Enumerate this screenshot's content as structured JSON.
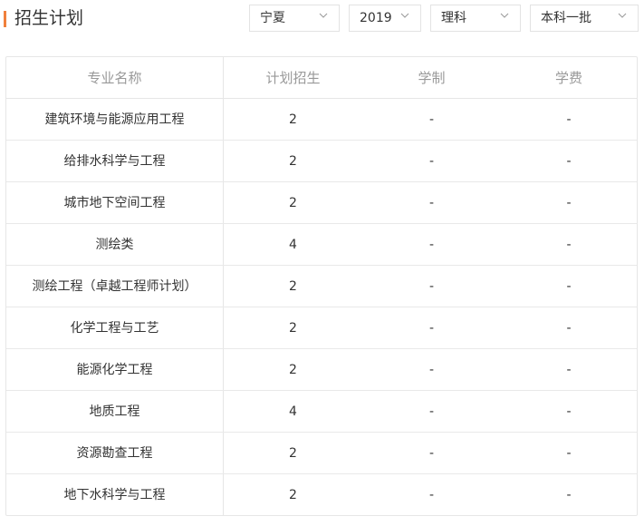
{
  "header": {
    "title": "招生计划"
  },
  "filters": {
    "province": "宁夏",
    "year": "2019",
    "category": "理科",
    "batch": "本科一批"
  },
  "table": {
    "headers": [
      "专业名称",
      "计划招生",
      "学制",
      "学费"
    ],
    "rows": [
      {
        "major": "建筑环境与能源应用工程",
        "plan": "2",
        "duration": "-",
        "fee": "-"
      },
      {
        "major": "给排水科学与工程",
        "plan": "2",
        "duration": "-",
        "fee": "-"
      },
      {
        "major": "城市地下空间工程",
        "plan": "2",
        "duration": "-",
        "fee": "-"
      },
      {
        "major": "测绘类",
        "plan": "4",
        "duration": "-",
        "fee": "-"
      },
      {
        "major": "测绘工程（卓越工程师计划）",
        "plan": "2",
        "duration": "-",
        "fee": "-"
      },
      {
        "major": "化学工程与工艺",
        "plan": "2",
        "duration": "-",
        "fee": "-"
      },
      {
        "major": "能源化学工程",
        "plan": "2",
        "duration": "-",
        "fee": "-"
      },
      {
        "major": "地质工程",
        "plan": "4",
        "duration": "-",
        "fee": "-"
      },
      {
        "major": "资源勘查工程",
        "plan": "2",
        "duration": "-",
        "fee": "-"
      },
      {
        "major": "地下水科学与工程",
        "plan": "2",
        "duration": "-",
        "fee": "-"
      }
    ]
  },
  "colors": {
    "accent": "#f0803c",
    "border": "#e6e6e6",
    "header_text": "#999999"
  }
}
